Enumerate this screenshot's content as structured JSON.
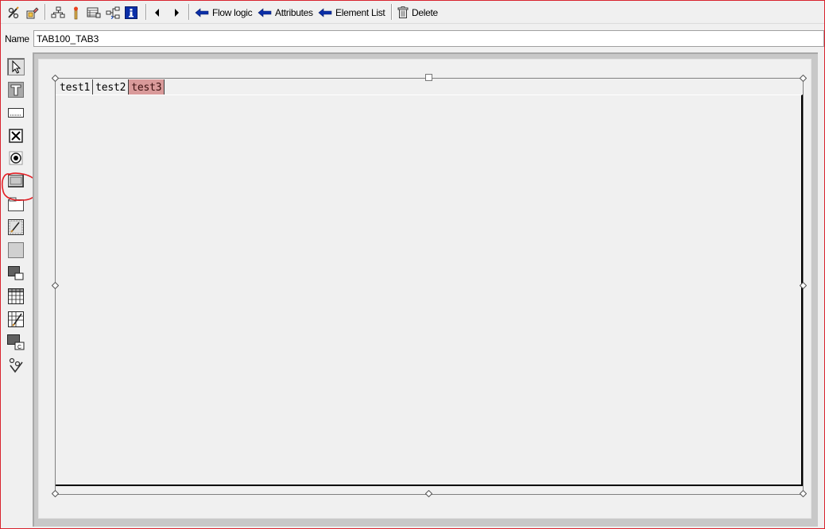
{
  "toolbar": {
    "icons": [
      "pencil-glasses-icon",
      "display-change-icon",
      "hierarchy-icon",
      "marker-icon",
      "layout-icon",
      "network-icon",
      "info-icon",
      "arrow-left-icon",
      "arrow-right-icon"
    ],
    "flow_logic": "Flow logic",
    "attributes": "Attributes",
    "element_list": "Element List",
    "delete": "Delete"
  },
  "name_row": {
    "label": "Name",
    "value": "TAB100_TAB3"
  },
  "palette": {
    "items": [
      "select-pointer-icon",
      "text-field-icon",
      "input-field-icon",
      "checkbox-icon",
      "radio-button-icon",
      "pushbutton-icon",
      "box-frame-icon",
      "subscreen-icon",
      "tabstrip-icon",
      "tabstrip-wizard-icon",
      "table-control-icon",
      "table-wizard-icon",
      "custom-control-icon",
      "status-icon"
    ]
  },
  "tabstrip": {
    "tabs": [
      "test1",
      "test2",
      "test3"
    ],
    "active_index": 2
  },
  "colors": {
    "active_tab": "#d99a9a",
    "frame_border": "#d9232e",
    "annotation": "#e31e24"
  }
}
